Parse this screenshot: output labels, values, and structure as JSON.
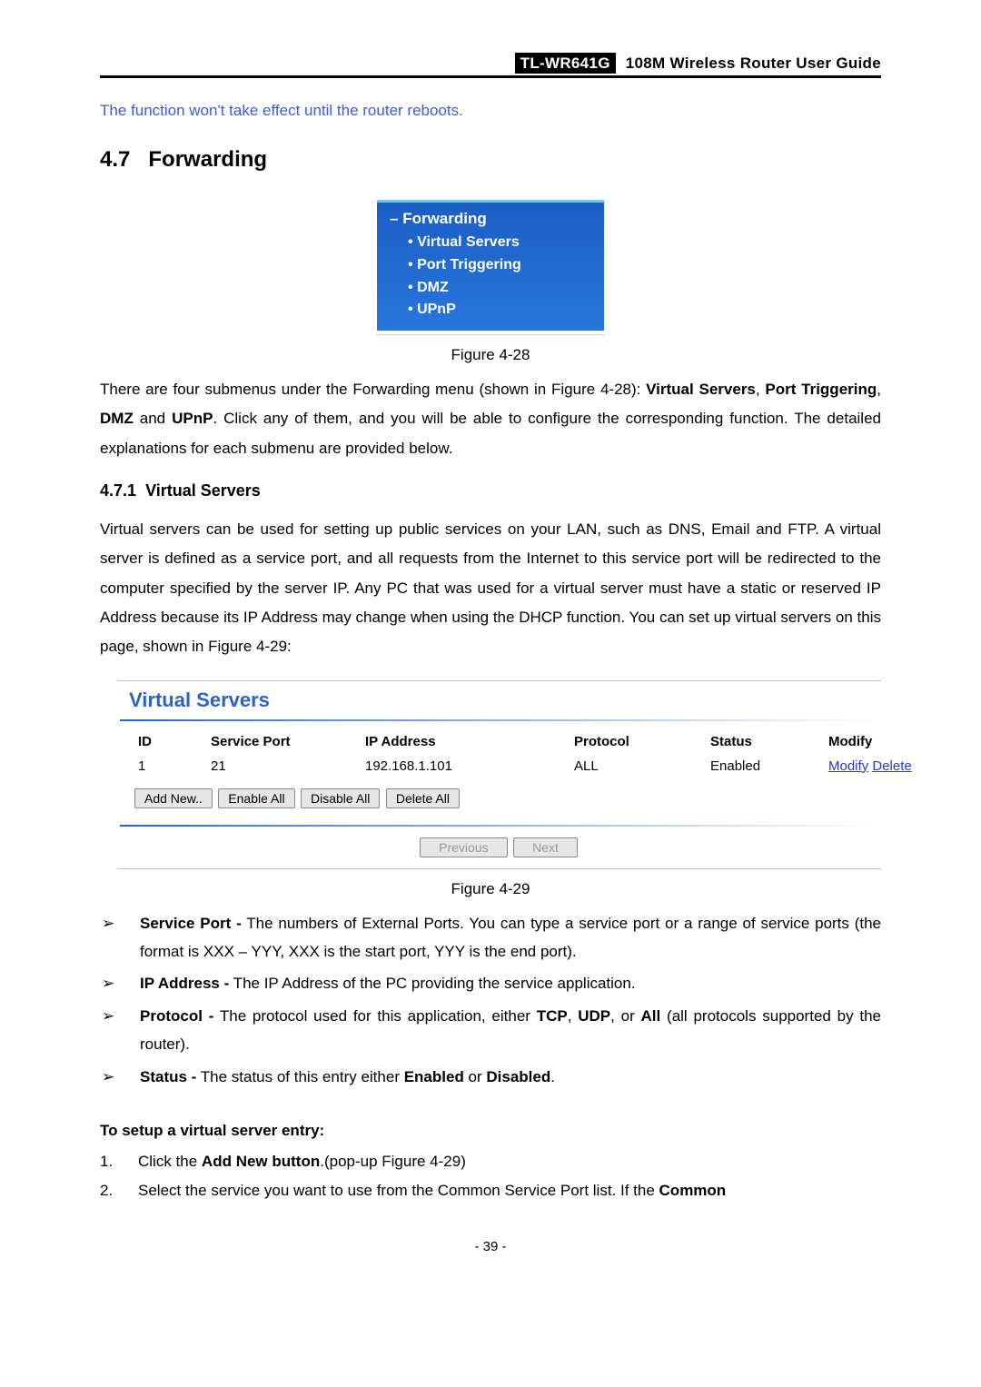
{
  "header": {
    "model": "TL-WR641G",
    "title": "108M Wireless Router User Guide"
  },
  "note": "The function won't take effect until the router reboots.",
  "section": {
    "number": "4.7",
    "title": "Forwarding"
  },
  "menu": {
    "root_prefix": "–",
    "root": "Forwarding",
    "items": [
      "Virtual Servers",
      "Port Triggering",
      "DMZ",
      "UPnP"
    ]
  },
  "fig28": "Figure 4-28",
  "para1_before": "There are four submenus under the Forwarding menu (shown in Figure 4-28): ",
  "para1_bold1": "Virtual Servers",
  "para1_mid1": ", ",
  "para1_bold2": "Port Triggering",
  "para1_mid2": ", ",
  "para1_bold3": "DMZ",
  "para1_mid3": " and ",
  "para1_bold4": "UPnP",
  "para1_after": ". Click any of them, and you will be able to configure the corresponding function. The detailed explanations for each submenu are provided below.",
  "subsection": {
    "number": "4.7.1",
    "title": "Virtual Servers"
  },
  "para2": "Virtual servers can be used for setting up public services on your LAN, such as DNS, Email and FTP. A virtual server is defined as a service port, and all requests from the Internet to this service port will be redirected to the computer specified by the server IP. Any PC that was used for a virtual server must have a static or reserved IP Address because its IP Address may change when using the DHCP function. You can set up virtual servers on this page, shown in Figure 4-29:",
  "vs": {
    "title": "Virtual Servers",
    "headers": [
      "ID",
      "Service Port",
      "IP Address",
      "Protocol",
      "Status",
      "Modify"
    ],
    "row": {
      "id": "1",
      "port": "21",
      "ip": "192.168.1.101",
      "proto": "ALL",
      "status": "Enabled",
      "modify": "Modify",
      "delete": "Delete"
    },
    "btn_add": "Add New..",
    "btn_enable": "Enable All",
    "btn_disable": "Disable All",
    "btn_delete": "Delete All",
    "btn_prev": "Previous",
    "btn_next": "Next"
  },
  "fig29": "Figure 4-29",
  "bullets": [
    {
      "boldLabel": "Service Port -",
      "text": " The numbers of External Ports. You can type a service port or a range of service ports (the format is XXX – YYY, XXX is the start port, YYY is the end port)."
    },
    {
      "boldLabel": "IP Address -",
      "text": " The IP Address of the PC providing the service application."
    },
    {
      "boldLabel": "Protocol -",
      "textPrefix": " The protocol used for this application, either ",
      "b1": "TCP",
      "m1": ", ",
      "b2": "UDP",
      "m2": ", or ",
      "b3": "All",
      "textSuffix": " (all protocols supported by the router)."
    },
    {
      "boldLabel": "Status -",
      "textPrefix": " The status of this entry either ",
      "b1": "Enabled",
      "m1": " or ",
      "b2": "Disabled",
      "textSuffix": "."
    }
  ],
  "setup": {
    "title": "To setup a virtual server entry:",
    "steps": [
      {
        "n": "1.",
        "pre": "Click the ",
        "bold": "Add New button",
        "post": ".(pop-up Figure 4-29)"
      },
      {
        "n": "2.",
        "pre": "Select the service you want to use from the Common Service Port list. If the ",
        "bold": "Common",
        "post": ""
      }
    ]
  },
  "footer": "- 39 -"
}
